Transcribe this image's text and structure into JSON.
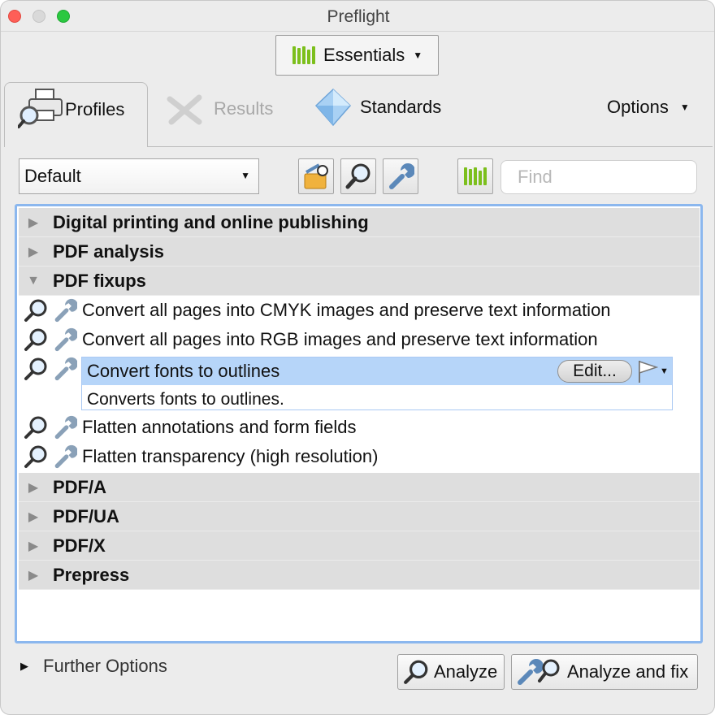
{
  "window": {
    "title": "Preflight"
  },
  "workspace": {
    "label": "Essentials"
  },
  "tabs": {
    "profiles": "Profiles",
    "results": "Results",
    "standards": "Standards",
    "options": "Options"
  },
  "toolbar": {
    "profile_select": "Default",
    "find_placeholder": "Find"
  },
  "list": {
    "groups": [
      "Digital printing and online publishing",
      "PDF analysis",
      "PDF fixups",
      "PDF/A",
      "PDF/UA",
      "PDF/X",
      "Prepress"
    ],
    "fixups": [
      "Convert all pages into CMYK images and preserve text information",
      "Convert all pages into RGB images and preserve text information",
      "Convert fonts to outlines",
      "Flatten annotations and form fields",
      "Flatten transparency (high resolution)"
    ],
    "selected": {
      "description": "Converts fonts to outlines.",
      "edit_label": "Edit..."
    }
  },
  "bottom": {
    "further_options": "Further Options",
    "analyze": "Analyze",
    "analyze_fix": "Analyze and fix"
  },
  "colors": {
    "accent_green": "#7cbf1c",
    "selection": "#b6d5f9",
    "focus_ring": "#8bb7ee",
    "wrench_blue": "#5b88b9"
  }
}
